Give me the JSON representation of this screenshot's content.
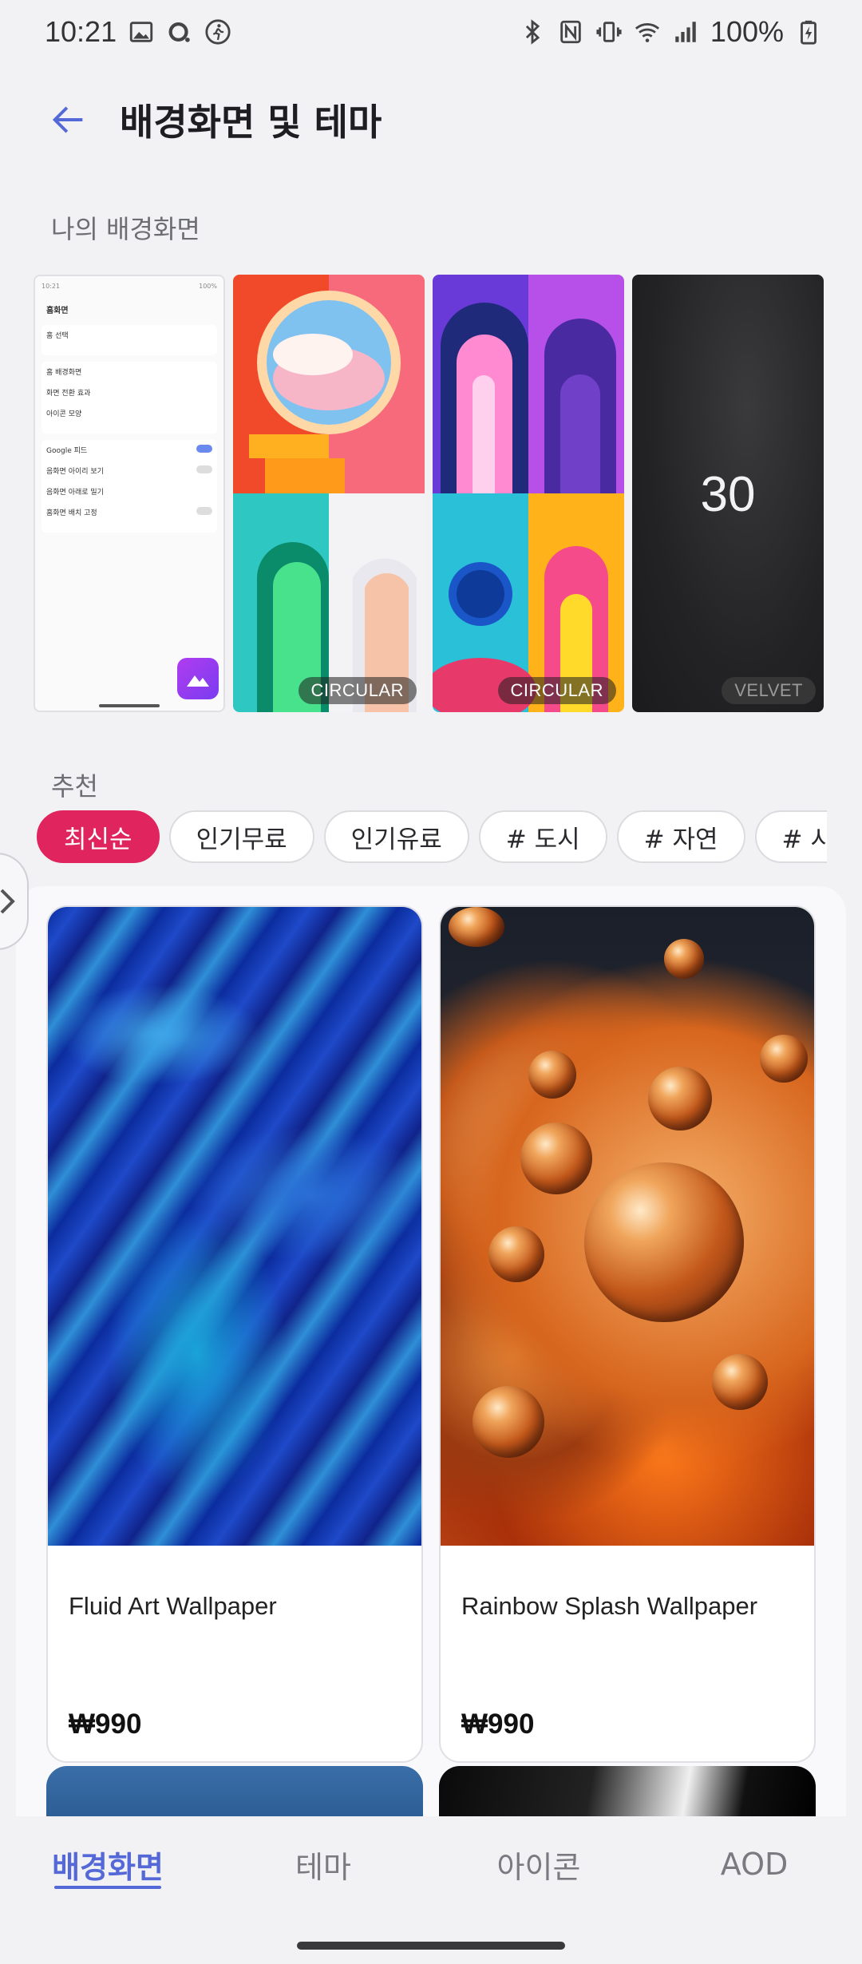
{
  "status_bar": {
    "time": "10:21",
    "battery": "100%",
    "icons_left": [
      "gallery-icon",
      "assistant-ring-icon",
      "walking-icon"
    ],
    "icons_right": [
      "bluetooth-icon",
      "nfc-icon",
      "vibrate-icon",
      "wifi-icon",
      "signal-icon",
      "battery-charging-icon"
    ]
  },
  "header": {
    "title": "배경화면 및 테마",
    "back_icon": "arrow-left-icon"
  },
  "my_wallpapers": {
    "label": "나의 배경화면",
    "current_preview": {
      "title": "홈화면",
      "rows": [
        "홈 선택",
        "홈 배경화면",
        "화면 전환 효과",
        "아이콘 모양",
        "Google 피드",
        "음화면 아이리 보기",
        "음화면 아래로 밀기",
        "홈화면 배치 고정"
      ]
    },
    "items": [
      {
        "badge": "CIRCULAR"
      },
      {
        "badge": "CIRCULAR"
      },
      {
        "badge": "VELVET",
        "number": "30"
      }
    ]
  },
  "recommend": {
    "label": "추천",
    "chips": [
      "최신순",
      "인기무료",
      "인기유료",
      "# 도시",
      "# 자연",
      "# 시원"
    ],
    "active_chip": 0
  },
  "products": [
    {
      "name": "Fluid Art Wallpaper",
      "price": "₩990"
    },
    {
      "name": "Rainbow Splash Wallpaper",
      "price": "₩990"
    }
  ],
  "bottom_nav": {
    "tabs": [
      "배경화면",
      "테마",
      "아이콘",
      "AOD"
    ],
    "active": 0,
    "accent": "#5468d8"
  },
  "colors": {
    "chip_active": "#e0245e",
    "accent": "#5468d8"
  }
}
